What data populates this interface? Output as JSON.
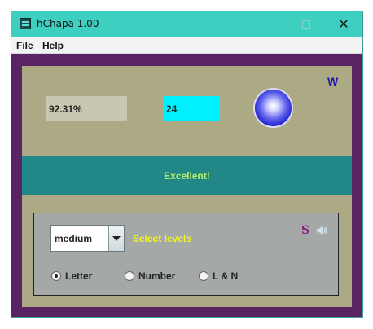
{
  "window": {
    "title": "hChapa 1.00"
  },
  "menu": {
    "file": "File",
    "help": "Help"
  },
  "scoreboard": {
    "percent": "92.31%",
    "count": "24",
    "w_label": "W",
    "status": "Excellent!"
  },
  "options": {
    "level_select": {
      "value": "medium"
    },
    "select_label": "Select levels",
    "s_label": "S",
    "modes": [
      {
        "label": "Letter",
        "checked": true
      },
      {
        "label": "Number",
        "checked": false
      },
      {
        "label": "L & N",
        "checked": false
      }
    ]
  },
  "colors": {
    "titlebar": "#3ecfc0",
    "frame": "#5a2364",
    "panel": "#aca985",
    "status_band": "#218787",
    "status_text": "#b4ef6a",
    "count_field": "#00f0ff",
    "select_label": "#f5f520"
  },
  "icons": {
    "app": "app-icon",
    "orb": "orb-indicator-icon",
    "speaker": "speaker-icon",
    "dropdown": "chevron-down-icon"
  }
}
